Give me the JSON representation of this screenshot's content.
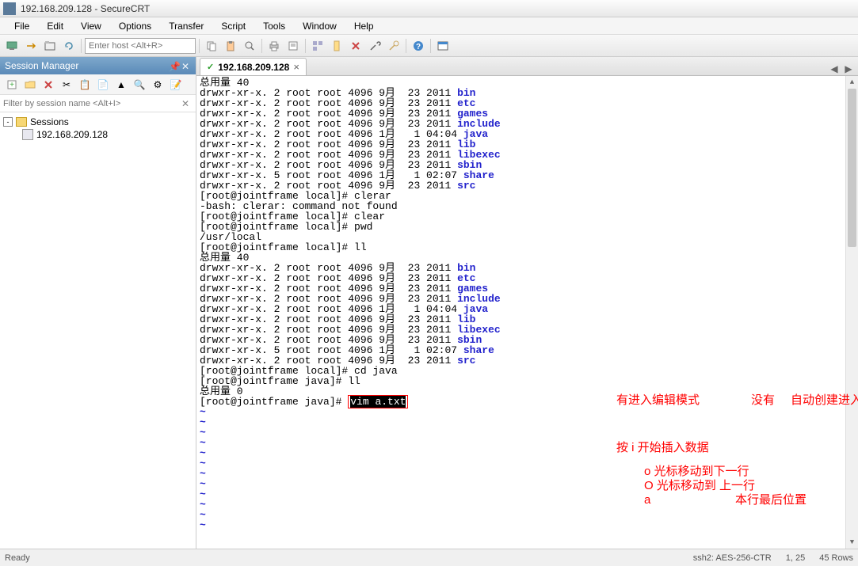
{
  "window": {
    "title": "192.168.209.128 - SecureCRT"
  },
  "menu": {
    "file": "File",
    "edit": "Edit",
    "view": "View",
    "options": "Options",
    "transfer": "Transfer",
    "script": "Script",
    "tools": "Tools",
    "window": "Window",
    "help": "Help"
  },
  "toolbar": {
    "host_placeholder": "Enter host <Alt+R>"
  },
  "session_manager": {
    "title": "Session Manager",
    "filter_placeholder": "Filter by session name <Alt+I>",
    "root": "Sessions",
    "items": [
      "192.168.209.128"
    ]
  },
  "tabs": {
    "active": "192.168.209.128"
  },
  "terminal": {
    "lines": [
      {
        "t": "总用量 40"
      },
      {
        "t": "drwxr-xr-x. 2 root root 4096 9月  23 2011 ",
        "suffix": "bin",
        "cls": "blue"
      },
      {
        "t": "drwxr-xr-x. 2 root root 4096 9月  23 2011 ",
        "suffix": "etc",
        "cls": "blue"
      },
      {
        "t": "drwxr-xr-x. 2 root root 4096 9月  23 2011 ",
        "suffix": "games",
        "cls": "blue"
      },
      {
        "t": "drwxr-xr-x. 2 root root 4096 9月  23 2011 ",
        "suffix": "include",
        "cls": "blue"
      },
      {
        "t": "drwxr-xr-x. 2 root root 4096 1月   1 04:04 ",
        "suffix": "java",
        "cls": "blue"
      },
      {
        "t": "drwxr-xr-x. 2 root root 4096 9月  23 2011 ",
        "suffix": "lib",
        "cls": "blue"
      },
      {
        "t": "drwxr-xr-x. 2 root root 4096 9月  23 2011 ",
        "suffix": "libexec",
        "cls": "blue"
      },
      {
        "t": "drwxr-xr-x. 2 root root 4096 9月  23 2011 ",
        "suffix": "sbin",
        "cls": "blue"
      },
      {
        "t": "drwxr-xr-x. 5 root root 4096 1月   1 02:07 ",
        "suffix": "share",
        "cls": "blue"
      },
      {
        "t": "drwxr-xr-x. 2 root root 4096 9月  23 2011 ",
        "suffix": "src",
        "cls": "blue"
      },
      {
        "t": "[root@jointframe local]# clerar"
      },
      {
        "t": "-bash: clerar: command not found"
      },
      {
        "t": "[root@jointframe local]# clear"
      },
      {
        "t": "[root@jointframe local]# pwd"
      },
      {
        "t": "/usr/local"
      },
      {
        "t": "[root@jointframe local]# ll"
      },
      {
        "t": "总用量 40"
      },
      {
        "t": "drwxr-xr-x. 2 root root 4096 9月  23 2011 ",
        "suffix": "bin",
        "cls": "blue"
      },
      {
        "t": "drwxr-xr-x. 2 root root 4096 9月  23 2011 ",
        "suffix": "etc",
        "cls": "blue"
      },
      {
        "t": "drwxr-xr-x. 2 root root 4096 9月  23 2011 ",
        "suffix": "games",
        "cls": "blue"
      },
      {
        "t": "drwxr-xr-x. 2 root root 4096 9月  23 2011 ",
        "suffix": "include",
        "cls": "blue"
      },
      {
        "t": "drwxr-xr-x. 2 root root 4096 1月   1 04:04 ",
        "suffix": "java",
        "cls": "blue"
      },
      {
        "t": "drwxr-xr-x. 2 root root 4096 9月  23 2011 ",
        "suffix": "lib",
        "cls": "blue"
      },
      {
        "t": "drwxr-xr-x. 2 root root 4096 9月  23 2011 ",
        "suffix": "libexec",
        "cls": "blue"
      },
      {
        "t": "drwxr-xr-x. 2 root root 4096 9月  23 2011 ",
        "suffix": "sbin",
        "cls": "blue"
      },
      {
        "t": "drwxr-xr-x. 5 root root 4096 1月   1 02:07 ",
        "suffix": "share",
        "cls": "blue"
      },
      {
        "t": "drwxr-xr-x. 2 root root 4096 9月  23 2011 ",
        "suffix": "src",
        "cls": "blue"
      },
      {
        "t": "[root@jointframe local]# cd java"
      },
      {
        "t": "[root@jointframe java]# ll"
      },
      {
        "t": "总用量 0"
      }
    ],
    "prompt_line_prefix": "[root@jointframe java]# ",
    "prompt_cmd": "vim a.txt",
    "tilde": "~"
  },
  "annotations": {
    "a1": "有进入编辑模式",
    "a2": "没有",
    "a3": "自动创建进入编辑模式",
    "a4": "按 i 开始插入数据",
    "a5": "o  光标移动到下一行",
    "a6": "O  光标移动到 上一行",
    "a7": "a",
    "a7b": "本行最后位置"
  },
  "statusbar": {
    "left": "Ready",
    "conn": "ssh2: AES-256-CTR",
    "pos": "1,  25",
    "rows": "45 Rows"
  }
}
